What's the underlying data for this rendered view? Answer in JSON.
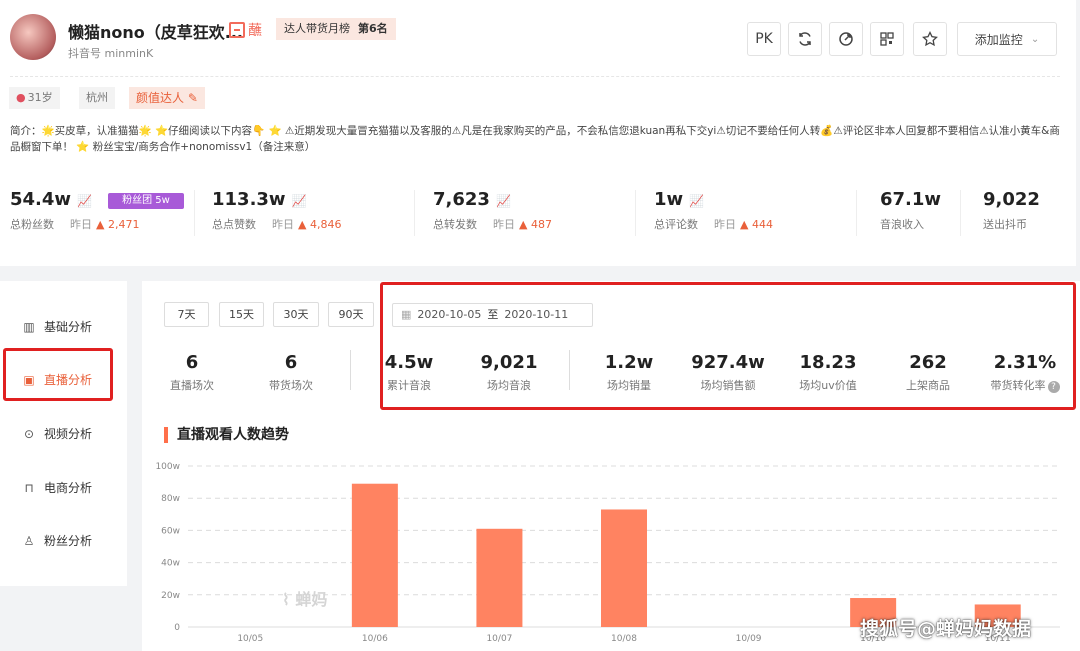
{
  "profile": {
    "name": "懒猫nono（皮草狂欢...",
    "store_icon": "蘸",
    "rank_label": "达人带货月榜",
    "rank_value": "第6名",
    "douyin_id": "抖音号 minminK",
    "tags": {
      "age": "31岁",
      "city": "杭州",
      "category": "颜值达人"
    },
    "bio": "简介：🌟买皮草，认准猫猫🌟 ⭐仔细阅读以下内容👇 ⭐ ⚠近期发现大量冒充猫猫以及客服的⚠凡是在我家购买的产品，不会私信您退kuan再私下交yi⚠切记不要给任何人转💰⚠评论区非本人回复都不要相信⚠认准小黄车&商品橱窗下单！ ⭐ 粉丝宝宝/商务合作+nonomissv1（备注来意）"
  },
  "toolbar": {
    "pk": "PK",
    "monitor": "添加监控"
  },
  "stats": [
    {
      "value": "54.4w",
      "label": "总粉丝数",
      "yesterday": "昨日",
      "delta": "2,471",
      "trend": true
    },
    {
      "value": "113.3w",
      "label": "总点赞数",
      "yesterday": "昨日",
      "delta": "4,846",
      "trend": true
    },
    {
      "value": "7,623",
      "label": "总转发数",
      "yesterday": "昨日",
      "delta": "487",
      "trend": true
    },
    {
      "value": "1w",
      "label": "总评论数",
      "yesterday": "昨日",
      "delta": "444",
      "trend": true
    },
    {
      "value": "67.1w",
      "label": "音浪收入"
    },
    {
      "value": "9,022",
      "label": "送出抖币"
    }
  ],
  "fan_club": "粉丝团 5w",
  "sidebar": [
    {
      "label": "基础分析",
      "icon": "bar-chart-icon"
    },
    {
      "label": "直播分析",
      "icon": "live-store-icon",
      "active": true
    },
    {
      "label": "视频分析",
      "icon": "play-circle-icon"
    },
    {
      "label": "电商分析",
      "icon": "shopping-bag-icon"
    },
    {
      "label": "粉丝分析",
      "icon": "user-icon"
    }
  ],
  "ranges": [
    "7天",
    "15天",
    "30天",
    "90天"
  ],
  "date_range": {
    "start": "2020-10-05",
    "to": "至",
    "end": "2020-10-11"
  },
  "metrics": [
    {
      "value": "6",
      "label": "直播场次"
    },
    {
      "value": "6",
      "label": "带货场次"
    },
    {
      "value": "4.5w",
      "label": "累计音浪"
    },
    {
      "value": "9,021",
      "label": "场均音浪"
    },
    {
      "value": "1.2w",
      "label": "场均销量"
    },
    {
      "value": "927.4w",
      "label": "场均销售额"
    },
    {
      "value": "18.23",
      "label": "场均uv价值"
    },
    {
      "value": "262",
      "label": "上架商品"
    },
    {
      "value": "2.31%",
      "label": "带货转化率"
    }
  ],
  "chart_title": "直播观看人数趋势",
  "chart_data": {
    "type": "bar",
    "categories": [
      "10/05",
      "10/06",
      "10/07",
      "10/08",
      "10/09",
      "10/10",
      "10/11"
    ],
    "values": [
      0,
      89,
      61,
      73,
      0,
      18,
      14
    ],
    "y_ticks": [
      "0",
      "20w",
      "40w",
      "60w",
      "80w",
      "100w"
    ],
    "ylim": [
      0,
      100
    ],
    "bar_color": "#ff8361",
    "grid": true
  },
  "chart_watermark": "蝉妈",
  "watermark": "搜狐号@蝉妈妈数据",
  "colors": {
    "accent": "#e9603a",
    "highlight_border": "#e02020",
    "fan_badge": "#a85ad8"
  }
}
